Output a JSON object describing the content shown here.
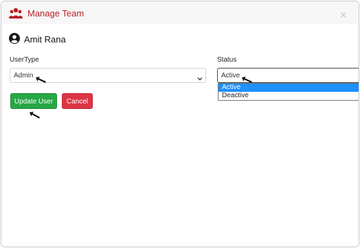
{
  "header": {
    "title": "Manage Team",
    "icon": "team-icon",
    "close_label": "×"
  },
  "user": {
    "icon": "user-circle-icon",
    "name": "Amit Rana"
  },
  "form": {
    "user_type": {
      "label": "UserType",
      "value": "Admin"
    },
    "status": {
      "label": "Status",
      "value": "Active",
      "options": [
        "Active",
        "Deactive"
      ],
      "highlighted_option": "Active"
    }
  },
  "buttons": {
    "update_label": "Update User",
    "cancel_label": "Cancel"
  },
  "colors": {
    "title": "#b81e27",
    "update_button": "#28a745",
    "cancel_button": "#dc3545",
    "option_highlight": "#1e90ff"
  }
}
